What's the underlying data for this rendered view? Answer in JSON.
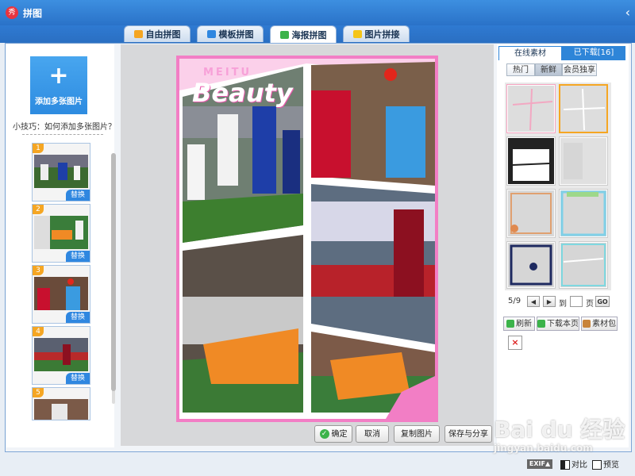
{
  "app": {
    "title": "拼图",
    "icon_glyph": "秀",
    "close_glyph": "‹"
  },
  "tabs": [
    {
      "label": "自由拼图",
      "icon_color": "#f5a623"
    },
    {
      "label": "模板拼图",
      "icon_color": "#2f87e0"
    },
    {
      "label": "海报拼图",
      "icon_color": "#3cb34a"
    },
    {
      "label": "图片拼接",
      "icon_color": "#f5c518"
    }
  ],
  "active_tab": "海报拼图",
  "left_panel": {
    "add_button": {
      "plus": "+",
      "label": "添加多张图片"
    },
    "tip": "小技巧：如何添加多张图片？",
    "thumbnails": [
      {
        "num": "1",
        "replace": "替换"
      },
      {
        "num": "2",
        "replace": "替换"
      },
      {
        "num": "3",
        "replace": "替换"
      },
      {
        "num": "4",
        "replace": "替换"
      },
      {
        "num": "5",
        "replace": ""
      }
    ]
  },
  "poster": {
    "logo_top": "MEITU",
    "logo_main": "Beauty",
    "border_color": "#f27ec5"
  },
  "actions": {
    "ok": "确定",
    "cancel": "取消",
    "copy": "复制图片",
    "save_share": "保存与分享",
    "ok_icon": "✓"
  },
  "right_panel": {
    "tabs": [
      "在线素材",
      "已下载[16]"
    ],
    "filters": [
      "热门",
      "新鲜",
      "会员独享"
    ],
    "active_filter": "新鲜",
    "pager": {
      "page": "5/9",
      "prev": "◀",
      "next": "▶",
      "to": "到",
      "page_suffix": "页",
      "go": "GO"
    },
    "tools": [
      "刷新",
      "下载本页",
      "素材包"
    ],
    "delete": "×"
  },
  "statusbar": {
    "exif": "EXIF▲",
    "compare": "对比",
    "preview": "预览"
  },
  "watermark": {
    "main": "Bai du 经验",
    "sub": "jingyan.baidu.com"
  }
}
